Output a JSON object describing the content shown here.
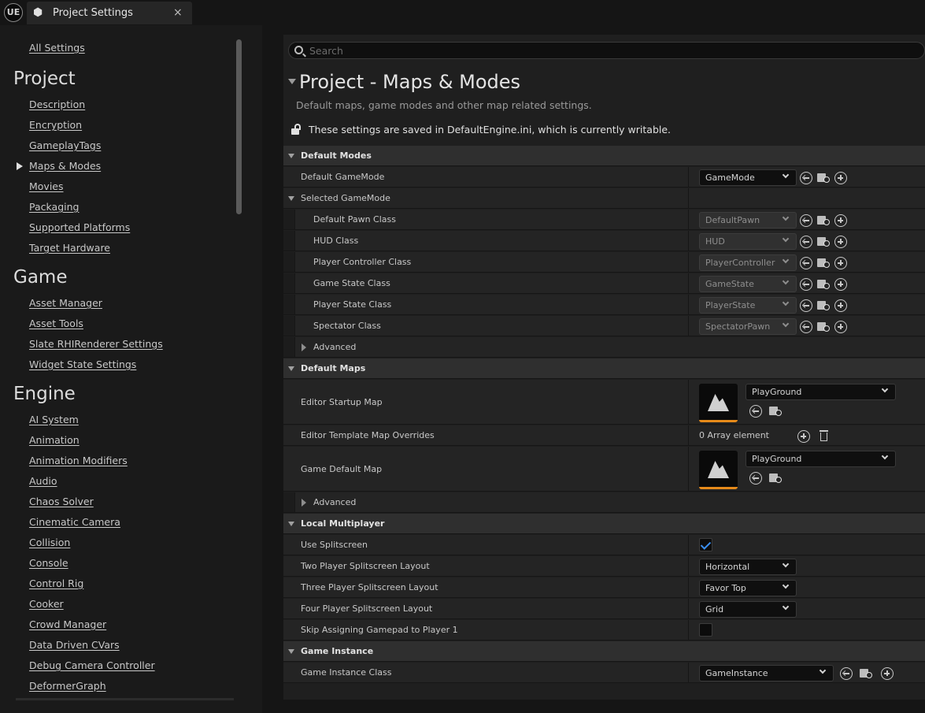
{
  "titlebar": {
    "logo": "UE",
    "tab_title": "Project Settings",
    "close_glyph": "×"
  },
  "sidebar": {
    "all_settings": "All Settings",
    "project_heading": "Project",
    "project_items": [
      "Description",
      "Encryption",
      "GameplayTags",
      "Maps & Modes",
      "Movies",
      "Packaging",
      "Supported Platforms",
      "Target Hardware"
    ],
    "game_heading": "Game",
    "game_items": [
      "Asset Manager",
      "Asset Tools",
      "Slate RHIRenderer Settings",
      "Widget State Settings"
    ],
    "engine_heading": "Engine",
    "engine_items": [
      "AI System",
      "Animation",
      "Animation Modifiers",
      "Audio",
      "Chaos Solver",
      "Cinematic Camera",
      "Collision",
      "Console",
      "Control Rig",
      "Cooker",
      "Crowd Manager",
      "Data Driven CVars",
      "Debug Camera Controller",
      "DeformerGraph"
    ]
  },
  "search": {
    "placeholder": "Search"
  },
  "header": {
    "title": "Project - Maps & Modes",
    "description": "Default maps, game modes and other map related settings.",
    "writable_note": "These settings are saved in DefaultEngine.ini, which is currently writable."
  },
  "default_modes": {
    "heading": "Default Modes",
    "default_gamemode": {
      "label": "Default GameMode",
      "value": "GameMode"
    },
    "selected_heading": "Selected GameMode",
    "selected": [
      {
        "label": "Default Pawn Class",
        "value": "DefaultPawn"
      },
      {
        "label": "HUD Class",
        "value": "HUD"
      },
      {
        "label": "Player Controller Class",
        "value": "PlayerController"
      },
      {
        "label": "Game State Class",
        "value": "GameState"
      },
      {
        "label": "Player State Class",
        "value": "PlayerState"
      },
      {
        "label": "Spectator Class",
        "value": "SpectatorPawn"
      }
    ],
    "advanced": "Advanced"
  },
  "default_maps": {
    "heading": "Default Maps",
    "editor_startup": {
      "label": "Editor Startup Map",
      "value": "PlayGround"
    },
    "template_overrides": {
      "label": "Editor Template Map Overrides",
      "value": "0 Array element"
    },
    "game_default": {
      "label": "Game Default Map",
      "value": "PlayGround"
    },
    "advanced": "Advanced"
  },
  "local_multiplayer": {
    "heading": "Local Multiplayer",
    "use_splitscreen": {
      "label": "Use Splitscreen",
      "checked": true
    },
    "two_player": {
      "label": "Two Player Splitscreen Layout",
      "value": "Horizontal"
    },
    "three_player": {
      "label": "Three Player Splitscreen Layout",
      "value": "Favor Top"
    },
    "four_player": {
      "label": "Four Player Splitscreen Layout",
      "value": "Grid"
    },
    "skip_gamepad": {
      "label": "Skip Assigning Gamepad to Player 1",
      "checked": false
    }
  },
  "game_instance": {
    "heading": "Game Instance",
    "class": {
      "label": "Game Instance Class",
      "value": "GameInstance"
    }
  },
  "colors": {
    "accent": "#e68a1a",
    "check": "#3a8ef0",
    "background": "#151515",
    "panel": "#242424",
    "category": "#2f2f2f"
  }
}
